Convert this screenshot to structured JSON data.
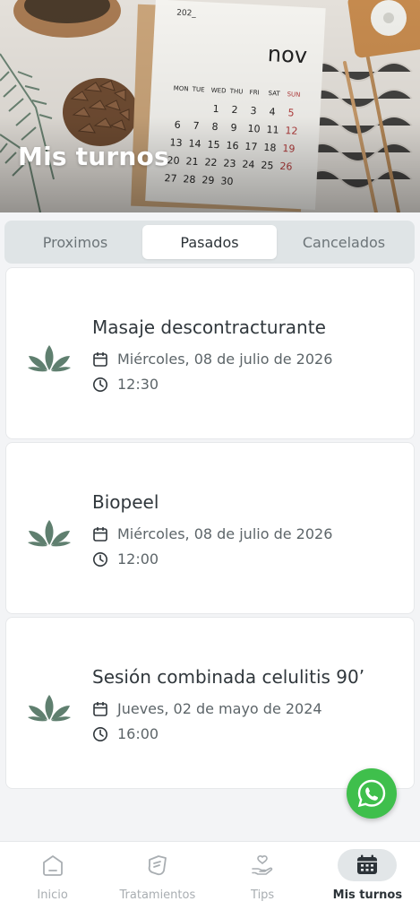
{
  "header": {
    "title": "Mis turnos",
    "calendar_image": {
      "year": "202_",
      "month": "nov",
      "weekdays": [
        "MON",
        "TUE",
        "WED",
        "THU",
        "FRI",
        "SAT",
        "SUN"
      ],
      "weeks": [
        [
          "",
          "",
          "",
          "1",
          "2",
          "3",
          "4",
          "5"
        ],
        [
          "6",
          "7",
          "8",
          "9",
          "10",
          "11",
          "12"
        ],
        [
          "13",
          "14",
          "15",
          "16",
          "17",
          "18",
          "19"
        ],
        [
          "20",
          "21",
          "22",
          "23",
          "24",
          "25",
          "26"
        ],
        [
          "27",
          "28",
          "29",
          "30"
        ]
      ]
    }
  },
  "tabs": [
    {
      "label": "Proximos",
      "active": false
    },
    {
      "label": "Pasados",
      "active": true
    },
    {
      "label": "Cancelados",
      "active": false
    }
  ],
  "appointments": [
    {
      "title": "Masaje descontracturante",
      "date": "Miércoles, 08 de julio de 2026",
      "time": "12:30",
      "icon": "leaf-icon"
    },
    {
      "title": "Biopeel",
      "date": "Miércoles, 08 de julio de 2026",
      "time": "12:00",
      "icon": "leaf-icon"
    },
    {
      "title": "Sesión combinada celulitis 90’",
      "date": "Jueves, 02 de mayo de 2024",
      "time": "16:00",
      "icon": "leaf-icon"
    }
  ],
  "floating": {
    "icon": "whatsapp-icon"
  },
  "bottom_nav": [
    {
      "label": "Inicio",
      "icon": "home-icon",
      "active": false
    },
    {
      "label": "Tratamientos",
      "icon": "treatments-icon",
      "active": false
    },
    {
      "label": "Tips",
      "icon": "tips-icon",
      "active": false
    },
    {
      "label": "Mis turnos",
      "icon": "calendar-icon",
      "active": true
    }
  ],
  "colors": {
    "accent_green": "#5f7f6f",
    "whatsapp_green": "#3fbf4c",
    "active_tab_bg": "#ffffff",
    "tab_bar_bg": "#dfe4e6"
  }
}
